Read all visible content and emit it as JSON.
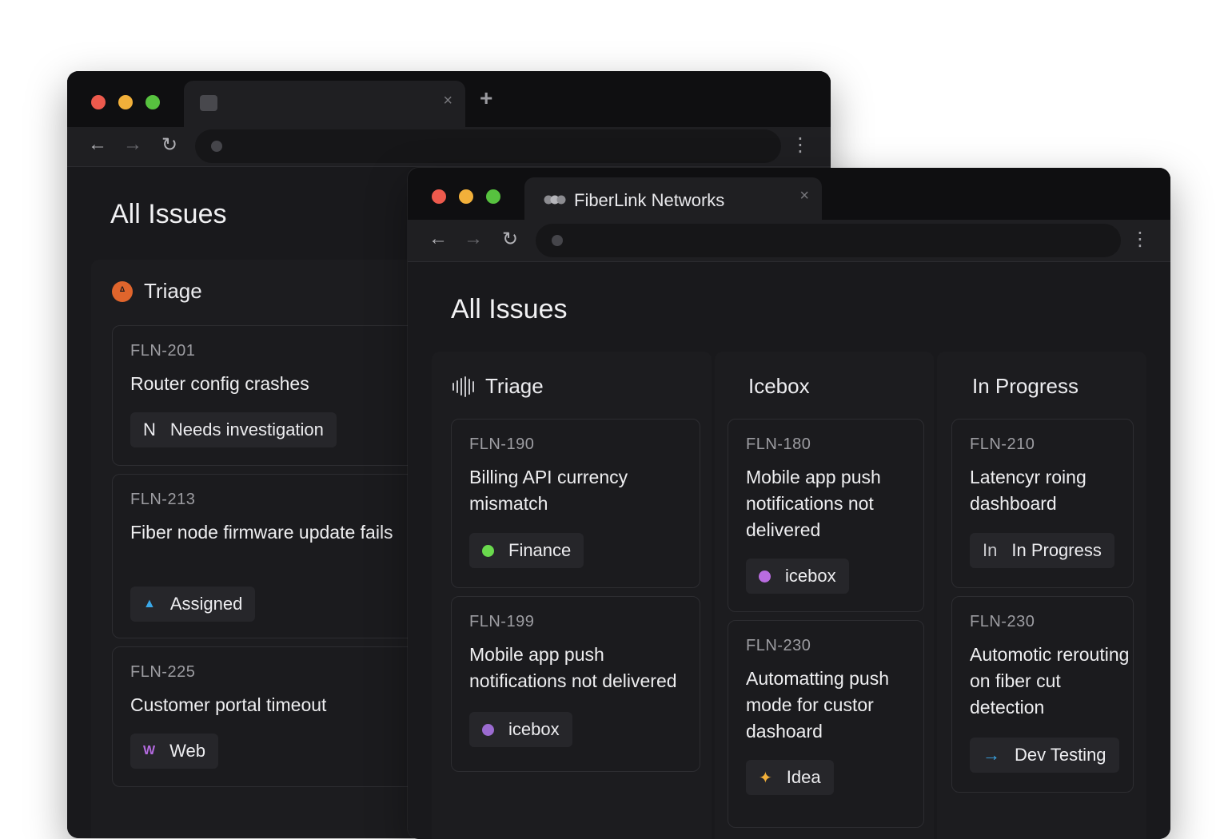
{
  "back_window": {
    "tab": {
      "title": "",
      "close": "×",
      "new_tab": "+"
    },
    "nav": {
      "back": "←",
      "forward": "→",
      "reload": "↻",
      "menu": "⋮"
    },
    "page_title": "All Issues",
    "column": {
      "name": "Triage",
      "cards": [
        {
          "id": "FLN-201",
          "title": "Router config crashes",
          "badge_prefix": "N",
          "badge": "Needs investigation"
        },
        {
          "id": "FLN-213",
          "title": "Fiber node firmware update fails",
          "badge_prefix": "▲",
          "badge": "Assigned"
        },
        {
          "id": "FLN-225",
          "title": "Customer portal timeout",
          "badge_prefix": "W",
          "badge": "Web"
        }
      ]
    }
  },
  "front_window": {
    "tab": {
      "title": "FiberLink Networks",
      "close": "×"
    },
    "nav": {
      "back": "←",
      "forward": "→",
      "reload": "↻",
      "menu": "⋮"
    },
    "page_title": "All Issues",
    "columns": [
      {
        "name": "Triage",
        "cards": [
          {
            "id": "FLN-190",
            "title": "Billing API currency mismatch",
            "badge": "Finance",
            "badge_color": "#6ad94d"
          },
          {
            "id": "FLN-199",
            "title": "Mobile app push notifications not delivered",
            "badge": "icebox",
            "badge_color": "#9b6bd0"
          }
        ]
      },
      {
        "name": "Icebox",
        "cards": [
          {
            "id": "FLN-180",
            "title": "Mobile app push notifications not delivered",
            "badge": "icebox",
            "badge_color": "#b96ce0"
          },
          {
            "id": "FLN-230",
            "title": "Automatting push mode for custor dashoard",
            "badge_prefix": "✦",
            "badge": "Idea",
            "badge_color": "#f2b03a"
          }
        ]
      },
      {
        "name": "In Progress",
        "cards": [
          {
            "id": "FLN-210",
            "title": "Latencyr roing dashboard",
            "badge_prefix": "In",
            "badge": "In Progress"
          },
          {
            "id": "FLN-230",
            "title": "Automotic rerouting on fiber cut detection",
            "badge_prefix": "→",
            "badge": "Dev Testing",
            "badge_color": "#3aa8e8"
          }
        ]
      }
    ]
  },
  "colors": {
    "triage_icon": "#e0652c",
    "assigned_icon": "#3aa8e8",
    "web_icon": "#b46ae0"
  }
}
